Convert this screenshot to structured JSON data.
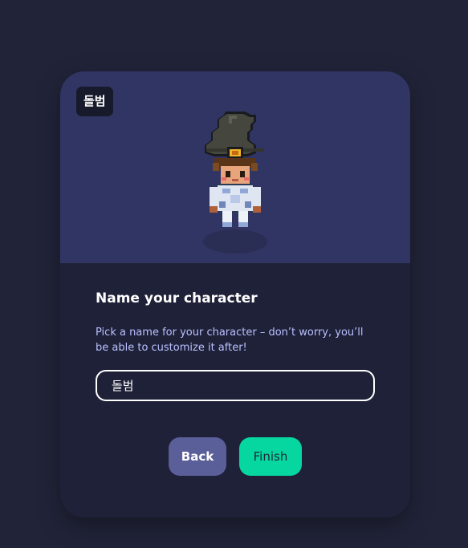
{
  "character": {
    "name_tag": "돌범"
  },
  "form": {
    "title": "Name your character",
    "description": "Pick a name for your character – don’t worry, you’ll be able to customize it after!",
    "name_value": "돌범"
  },
  "buttons": {
    "back_label": "Back",
    "finish_label": "Finish"
  },
  "colors": {
    "page_bg": "#212439",
    "preview_bg": "#313563",
    "accent": "#06d6a0",
    "secondary_button": "#5b5f99",
    "description_text": "#b9c0ff"
  },
  "icons": {
    "character_sprite": "witch-hat-character-sprite"
  }
}
